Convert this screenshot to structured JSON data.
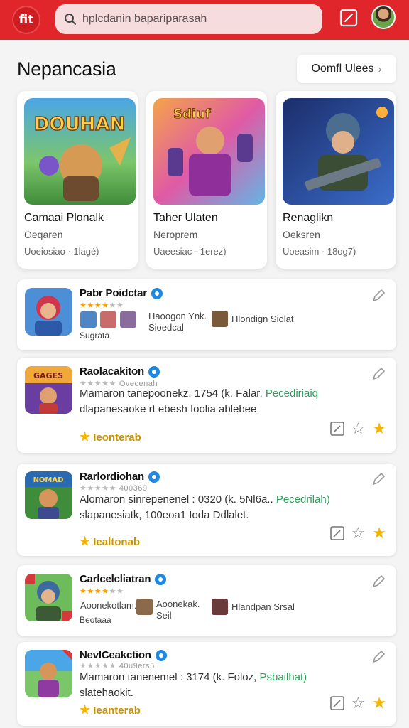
{
  "header": {
    "logo_text": "fit",
    "search_placeholder": "hplcdanin bapariparasah",
    "brand_color": "#e0262b"
  },
  "section": {
    "title": "Nepancasia",
    "view_all_label": "Oomfl Ulees",
    "view_all_arrow": "›"
  },
  "featured": [
    {
      "title": "Camaai Plonalk",
      "subtitle": "Oeqaren",
      "meta": "Uoeiosiao · 1lagé)",
      "art_text": "DOUHAN"
    },
    {
      "title": "Taher Ulaten",
      "subtitle": "Neroprem",
      "meta": "Uaeesiac · 1erez)",
      "art_text": "Sdiuf"
    },
    {
      "title": "Renaglikn",
      "subtitle": "Oeksren",
      "meta": "Uoeasim · 18og7)",
      "art_text": ""
    }
  ],
  "list": [
    {
      "name": "Pabr Poidctar",
      "rating": 4,
      "developers": [
        {
          "text": "Haoogon Ynk.\nSioedcal"
        },
        {
          "text": "Hlondign Siolat"
        }
      ],
      "tagline": "Sugrata"
    },
    {
      "name": "Raolacakiton",
      "rating": 0,
      "rating_count": "Ovecenah",
      "desc_line1": "Mamaron tanepoonekz. 1754 (k. Falar, ",
      "desc_line1_green": "Pecediriaiq",
      "desc_line2": "dlapanesaoke rt ebesh Ioolia ablebee.",
      "badge": "Ieonterab",
      "thumb_text": "GAGES"
    },
    {
      "name": "Rarlordiohan",
      "rating": 0,
      "rating_count": "400369",
      "desc_line1": "Alomaron sinrepenenel : 0320 (k. 5Nl6a.. ",
      "desc_line1_green": "Pecedrilah)",
      "desc_line2": "slapanesiatk, 100eoa1 Ioda Ddlalet.",
      "badge": "Iealtonab",
      "thumb_text": "NOMAD"
    },
    {
      "name": "Carlcelcliatran",
      "rating": 4,
      "developers": [
        {
          "text": "Aoonekotlam."
        },
        {
          "text": "Aoonekak.\nSeil"
        },
        {
          "text": "Hlandpan Srsal"
        }
      ],
      "tagline": "Beotaaa"
    },
    {
      "name": "NevlCeakction",
      "rating": 0,
      "rating_count": "40u9ers5",
      "desc_line1": "Mamaron tanenemel : 3174 (k. Foloz, ",
      "desc_line1_green": "Psbailhat)",
      "desc_line2": "slatehaokit.",
      "badge": "Ieanterab"
    }
  ]
}
